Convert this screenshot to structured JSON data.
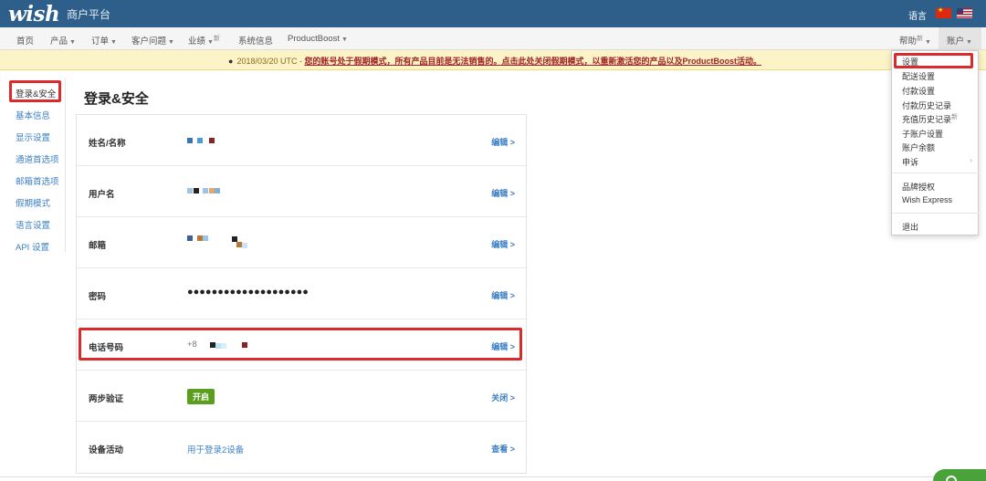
{
  "topbar": {
    "logo": "wish",
    "platform_title": "商户平台",
    "language_label": "语言"
  },
  "nav": {
    "items": [
      {
        "label": "首页"
      },
      {
        "label": "产品"
      },
      {
        "label": "订单"
      },
      {
        "label": "客户问题"
      },
      {
        "label": "业绩"
      },
      {
        "label": "系统信息"
      },
      {
        "label": "ProductBoost"
      }
    ],
    "new_badge": "新",
    "help": "帮助",
    "account": "账户"
  },
  "banner": {
    "date_text": "2018/03/20 UTC -",
    "warning_text": "您的账号处于假期模式，所有产品目前是无法销售的。点击此处关闭假期模式，以重新激活您的产品以及ProductBoost活动。"
  },
  "sidebar": {
    "items": [
      {
        "label": "登录&安全",
        "active": true
      },
      {
        "label": "基本信息"
      },
      {
        "label": "显示设置"
      },
      {
        "label": "通道首选项"
      },
      {
        "label": "邮箱首选项"
      },
      {
        "label": "假期模式"
      },
      {
        "label": "语言设置"
      },
      {
        "label": "API 设置"
      }
    ]
  },
  "main": {
    "title": "登录&安全",
    "rows": [
      {
        "label": "姓名/名称",
        "action": "编辑 >"
      },
      {
        "label": "用户名",
        "action": "编辑 >"
      },
      {
        "label": "邮箱",
        "action": "编辑 >"
      },
      {
        "label": "密码",
        "value": "●●●●●●●●●●●●●●●●●●●●",
        "action": "编辑 >"
      },
      {
        "label": "电话号码",
        "value": "+8",
        "action": "编辑 >"
      },
      {
        "label": "两步验证",
        "value": "开启",
        "action": "关闭 >"
      },
      {
        "label": "设备活动",
        "value": "用于登录2设备",
        "action": "查看 >"
      }
    ]
  },
  "dropdown": {
    "items": [
      {
        "label": "设置"
      },
      {
        "label": "配送设置"
      },
      {
        "label": "付款设置"
      },
      {
        "label": "付款历史记录"
      },
      {
        "label": "充值历史记录"
      },
      {
        "label": "子账户设置"
      },
      {
        "label": "账户余额"
      },
      {
        "label": "申诉"
      },
      {
        "label": "品牌授权"
      },
      {
        "label": "Wish Express"
      },
      {
        "label": "退出"
      }
    ],
    "new_badge": "新"
  },
  "colors": {
    "topbar": "#2d5f8a",
    "link": "#3b7fc4",
    "highlight": "#d92b2b",
    "badge_on": "#5a9e1e",
    "banner_bg": "#fcf4c6"
  }
}
